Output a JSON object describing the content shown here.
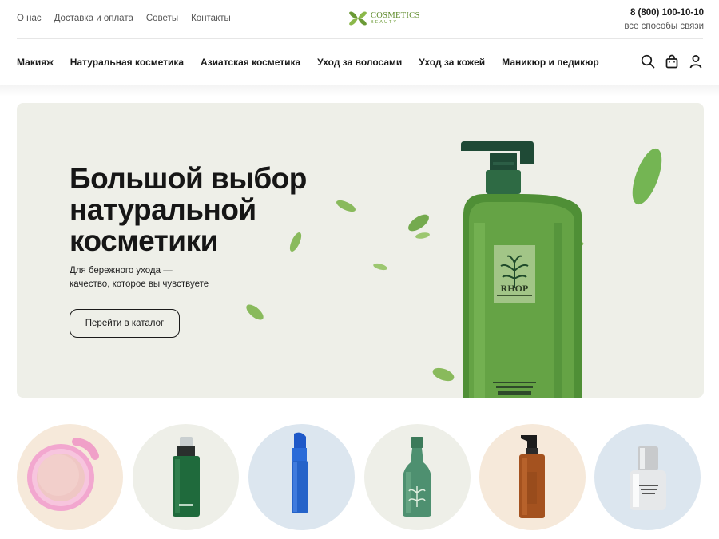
{
  "header": {
    "top_links": [
      "О нас",
      "Доставка и оплата",
      "Советы",
      "Контакты"
    ],
    "logo": {
      "main": "COSMETICS",
      "sub": "BEAUTY"
    },
    "phone": "8 (800) 100-10-10",
    "contact_link": "все способы связи"
  },
  "nav": {
    "items": [
      "Макияж",
      "Натуральная косметика",
      "Азиатская косметика",
      "Уход за волосами",
      "Уход за кожей",
      "Маникюр и педикюр"
    ],
    "icons": [
      "search-icon",
      "cart-icon",
      "user-icon"
    ]
  },
  "hero": {
    "title_lines": [
      "Большой выбор",
      "натуральной",
      "косметики"
    ],
    "subtitle_lines": [
      "Для бережного ухода —",
      "качество, которое вы чувствуете"
    ],
    "button_label": "Перейти в каталог",
    "product_label_text": "RHOP"
  },
  "categories": [
    {
      "product": "pink-compact-powder",
      "bg": "#f6e9da"
    },
    {
      "product": "green-serum-bottle",
      "bg": "#eeefe8"
    },
    {
      "product": "blue-lipstick",
      "bg": "#dce6ef"
    },
    {
      "product": "green-herbal-bottle",
      "bg": "#eeefe8"
    },
    {
      "product": "amber-pump-bottle",
      "bg": "#f6e9da"
    },
    {
      "product": "silver-nail-polish",
      "bg": "#dce6ef"
    }
  ],
  "colors": {
    "brand_green": "#5d8a2a",
    "hero_bg": "#eeefe8",
    "text_dark": "#1a1a1a"
  }
}
